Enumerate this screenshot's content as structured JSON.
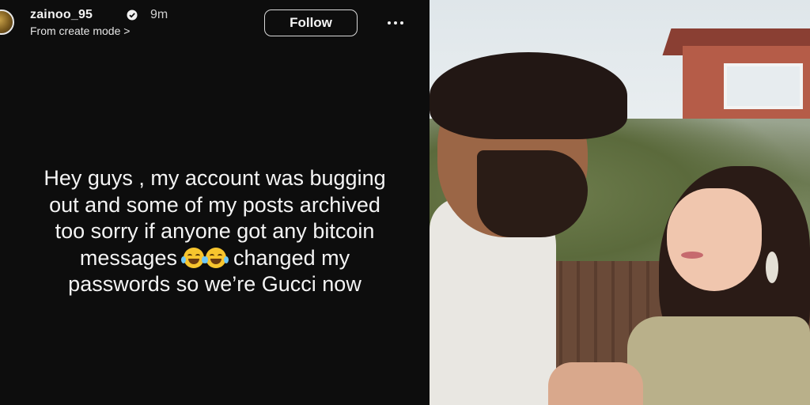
{
  "story": {
    "username": "zainoo_95",
    "time_ago": "9m",
    "subline": "From create mode >",
    "follow_label": "Follow",
    "text_lines": [
      "Hey guys , my account was bugging",
      "out and some of my posts archived",
      "too sorry if anyone got any bitcoin",
      "changed my",
      "passwords so we’re Gucci now"
    ],
    "messages_word": "messages",
    "icons": [
      "verified-badge-icon",
      "more-options-icon",
      "laughing-crying-emoji"
    ]
  },
  "photo": {
    "description_visible": false
  }
}
